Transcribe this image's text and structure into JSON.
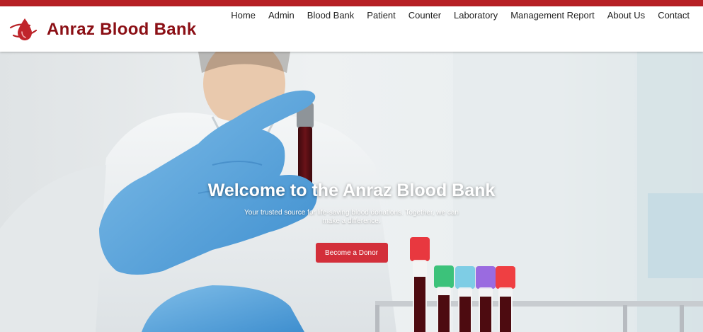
{
  "brand": {
    "name": "Anraz Blood Bank",
    "logo_icon": "blood-drop-logo-icon",
    "color": "#8b0f15"
  },
  "accent_color": "#b72025",
  "nav": {
    "items": [
      {
        "label": "Home"
      },
      {
        "label": "Admin"
      },
      {
        "label": "Blood Bank"
      },
      {
        "label": "Patient"
      },
      {
        "label": "Counter"
      },
      {
        "label": "Laboratory"
      },
      {
        "label": "Management Report"
      },
      {
        "label": "About Us"
      },
      {
        "label": "Contact"
      }
    ]
  },
  "hero": {
    "title": "Welcome to the Anraz Blood Bank",
    "subtitle": "Your trusted source for life-saving blood donations. Together, we can make a difference.",
    "button_label": "Become a Donor",
    "button_color": "#d32f3a"
  }
}
